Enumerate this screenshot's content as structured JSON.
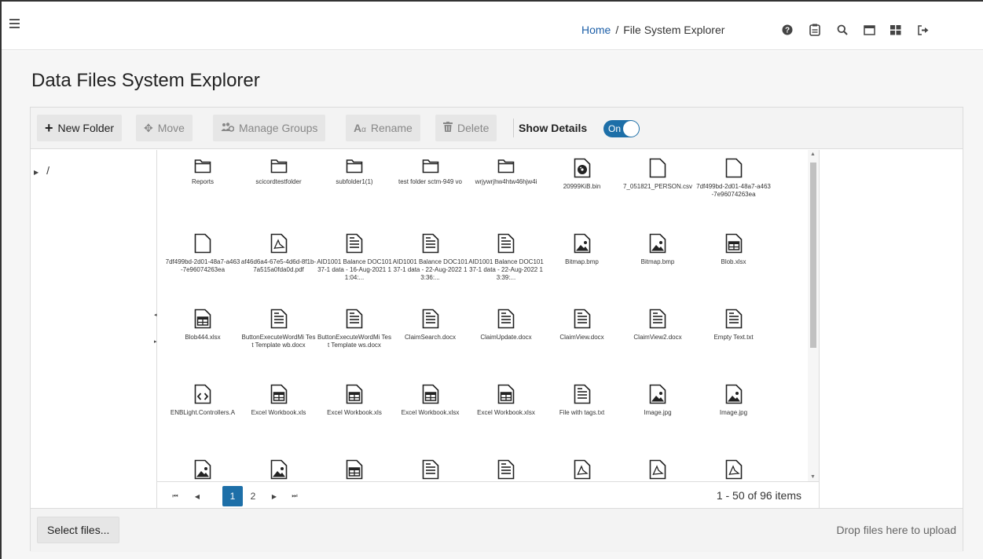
{
  "header": {
    "breadcrumb": [
      {
        "label": "Home"
      },
      {
        "label": "/"
      },
      {
        "label": "File System Explorer"
      }
    ],
    "icons": [
      "help-icon",
      "id-card-icon",
      "search-icon",
      "window-icon",
      "grid-icon",
      "logout-icon"
    ]
  },
  "page": {
    "title": "Data Files System Explorer"
  },
  "toolbar": {
    "new_folder": "New Folder",
    "move": "Move",
    "manage_groups": "Manage Groups",
    "rename": "Rename",
    "delete": "Delete",
    "show_details": "Show Details",
    "toggle_label": "On"
  },
  "tree": {
    "root": "/"
  },
  "files": [
    {
      "name": "Reports",
      "icon": "folder"
    },
    {
      "name": "scicordtestfolder",
      "icon": "folder"
    },
    {
      "name": "subfolder1(1)",
      "icon": "folder"
    },
    {
      "name": "test folder sctm-949 vo",
      "icon": "folder"
    },
    {
      "name": "wrjywrjhw4htw46hjw4i",
      "icon": "folder"
    },
    {
      "name": "20999KiB.bin",
      "icon": "disc"
    },
    {
      "name": "7_051821_PERSON.csv",
      "icon": "file"
    },
    {
      "name": "7df499bd-2d01-48a7-a463-7e96074263ea",
      "icon": "file"
    },
    {
      "name": "7df499bd-2d01-48a7-a463-7e96074263ea",
      "icon": "file"
    },
    {
      "name": "af46d6a4-67e5-4d6d-8f1b-7a515a0fda0d.pdf",
      "icon": "pdf"
    },
    {
      "name": "AID1001 Balance DOC10137-1 data - 16-Aug-2021 11:04:...",
      "icon": "doc"
    },
    {
      "name": "AID1001 Balance DOC10137-1 data - 22-Aug-2022 13:36:...",
      "icon": "doc"
    },
    {
      "name": "AID1001 Balance DOC10137-1 data - 22-Aug-2022 13:39:...",
      "icon": "doc"
    },
    {
      "name": "Bitmap.bmp",
      "icon": "image"
    },
    {
      "name": "Bitmap.bmp",
      "icon": "image"
    },
    {
      "name": "Blob.xlsx",
      "icon": "sheet"
    },
    {
      "name": "Blob444.xlsx",
      "icon": "sheet"
    },
    {
      "name": "ButtonExecuteWordMi Test Template wb.docx",
      "icon": "doc"
    },
    {
      "name": "ButtonExecuteWordMi Test Template ws.docx",
      "icon": "doc"
    },
    {
      "name": "ClaimSearch.docx",
      "icon": "doc"
    },
    {
      "name": "ClaimUpdate.docx",
      "icon": "doc"
    },
    {
      "name": "ClaimView.docx",
      "icon": "doc"
    },
    {
      "name": "ClaimView2.docx",
      "icon": "doc"
    },
    {
      "name": "Empty Text.txt",
      "icon": "doc"
    },
    {
      "name": "ENBLight.Controllers.A",
      "icon": "code"
    },
    {
      "name": "Excel Workbook.xls",
      "icon": "sheet"
    },
    {
      "name": "Excel Workbook.xls",
      "icon": "sheet"
    },
    {
      "name": "Excel Workbook.xlsx",
      "icon": "sheet"
    },
    {
      "name": "Excel Workbook.xlsx",
      "icon": "sheet"
    },
    {
      "name": "File with tags.txt",
      "icon": "doc"
    },
    {
      "name": "Image.jpg",
      "icon": "image"
    },
    {
      "name": "Image.jpg",
      "icon": "image"
    },
    {
      "name": "",
      "icon": "image"
    },
    {
      "name": "",
      "icon": "image"
    },
    {
      "name": "",
      "icon": "sheet"
    },
    {
      "name": "",
      "icon": "doc"
    },
    {
      "name": "",
      "icon": "doc"
    },
    {
      "name": "",
      "icon": "pdf"
    },
    {
      "name": "",
      "icon": "pdf"
    },
    {
      "name": "",
      "icon": "pdf"
    }
  ],
  "pager": {
    "pages": [
      "1",
      "2"
    ],
    "current": "1",
    "info": "1 - 50 of 96 items"
  },
  "upload": {
    "select_label": "Select files...",
    "drop_hint": "Drop files here to upload"
  },
  "colors": {
    "accent": "#1d6fa8",
    "link": "#1d5fa8"
  }
}
